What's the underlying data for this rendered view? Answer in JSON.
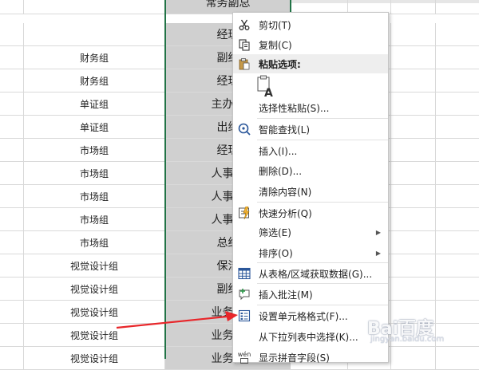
{
  "sheet": {
    "rows": [
      {
        "dept": "",
        "title": "常务副总"
      },
      {
        "dept": "",
        "title": "经理"
      },
      {
        "dept": "财务组",
        "title": "副经"
      },
      {
        "dept": "财务组",
        "title": "经理"
      },
      {
        "dept": "单证组",
        "title": "主办会"
      },
      {
        "dept": "单证组",
        "title": "出纳"
      },
      {
        "dept": "市场组",
        "title": "经理"
      },
      {
        "dept": "市场组",
        "title": "人事行"
      },
      {
        "dept": "市场组",
        "title": "人事行"
      },
      {
        "dept": "市场组",
        "title": "人事行"
      },
      {
        "dept": "市场组",
        "title": "总经"
      },
      {
        "dept": "视觉设计组",
        "title": "保洁"
      },
      {
        "dept": "视觉设计组",
        "title": "副经"
      },
      {
        "dept": "视觉设计组",
        "title": "业务员"
      },
      {
        "dept": "视觉设计组",
        "title": "业务员"
      },
      {
        "dept": "视觉设计组",
        "title": "业务员"
      }
    ]
  },
  "context_menu": {
    "cut": "剪切(T)",
    "copy": "复制(C)",
    "paste_options_header": "粘贴选项:",
    "paste_special": "选择性粘贴(S)...",
    "smart_lookup": "智能查找(L)",
    "insert": "插入(I)...",
    "delete": "删除(D)...",
    "clear_contents": "清除内容(N)",
    "quick_analysis": "快速分析(Q)",
    "filter": "筛选(E)",
    "sort": "排序(O)",
    "get_data_from_table": "从表格/区域获取数据(G)...",
    "insert_comment": "插入批注(M)",
    "format_cells": "设置单元格格式(F)...",
    "pick_from_dropdown": "从下拉列表中选择(K)...",
    "show_phonetic": "显示拼音字段(S)",
    "phonetic_icon_text": "wén"
  },
  "watermark": {
    "brand": "Bai百度",
    "sub": "jingyan.baidu.com"
  },
  "colors": {
    "selection_fill": "#d0d0d0",
    "selection_border": "#217346",
    "annotation_arrow": "#e8262a"
  }
}
